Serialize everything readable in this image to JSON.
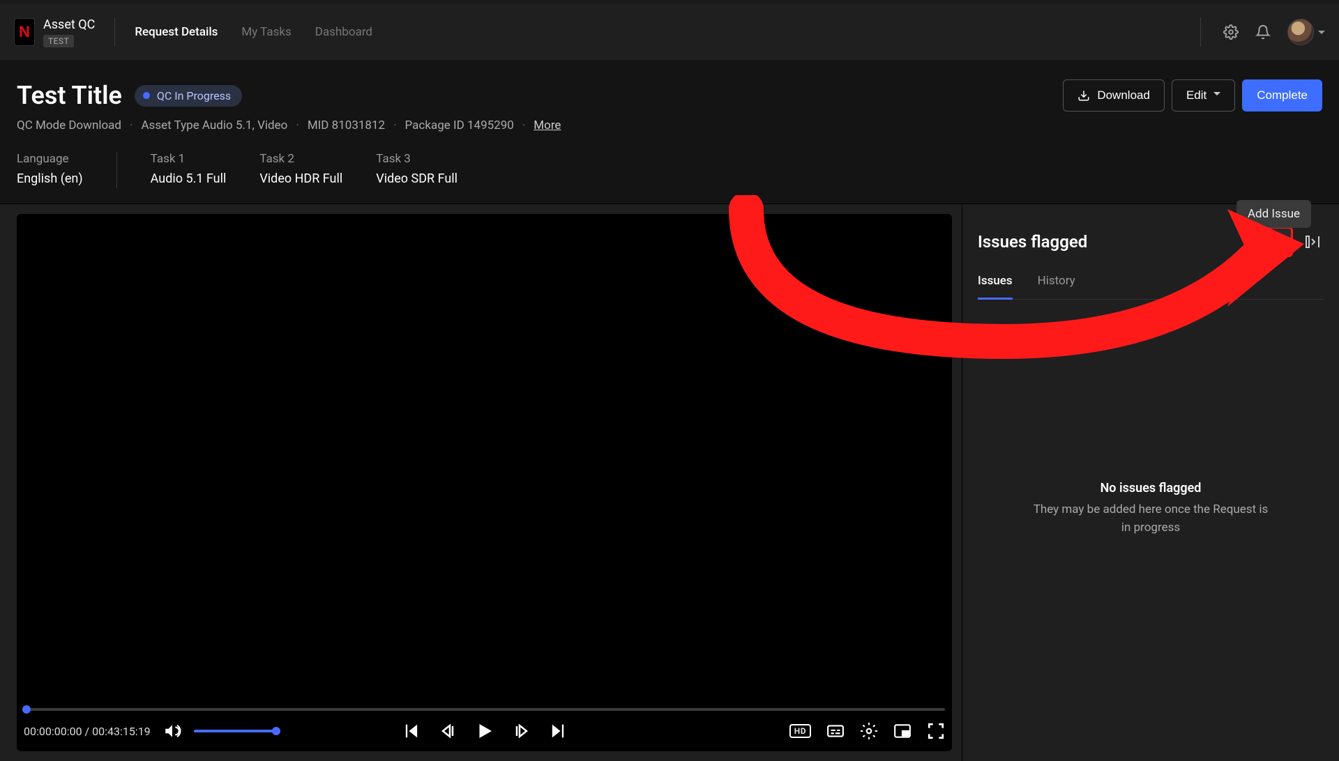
{
  "brand": {
    "title": "Asset QC",
    "badge": "TEST",
    "logo_letter": "N"
  },
  "nav": {
    "request_details": "Request Details",
    "my_tasks": "My Tasks",
    "dashboard": "Dashboard"
  },
  "page": {
    "title": "Test Title",
    "status": "QC In Progress",
    "meta": {
      "qc_mode": "QC Mode Download",
      "asset_type": "Asset Type Audio 5.1, Video",
      "mid": "MID 81031812",
      "package_id": "Package ID 1495290",
      "more": "More"
    },
    "info": {
      "language_label": "Language",
      "language_value": "English (en)",
      "task1_label": "Task 1",
      "task1_value": "Audio 5.1 Full",
      "task2_label": "Task 2",
      "task2_value": "Video HDR Full",
      "task3_label": "Task 3",
      "task3_value": "Video SDR Full"
    },
    "actions": {
      "download": "Download",
      "edit": "Edit",
      "complete": "Complete"
    }
  },
  "player": {
    "current_time": "00:00:00:00",
    "separator": " / ",
    "duration": "00:43:15:19",
    "hd_label": "HD"
  },
  "sidebar": {
    "title": "Issues flagged",
    "tooltip": "Add Issue",
    "tabs": {
      "issues": "Issues",
      "history": "History"
    },
    "empty_title": "No issues flagged",
    "empty_sub": "They may be added here once the Request is in progress"
  }
}
